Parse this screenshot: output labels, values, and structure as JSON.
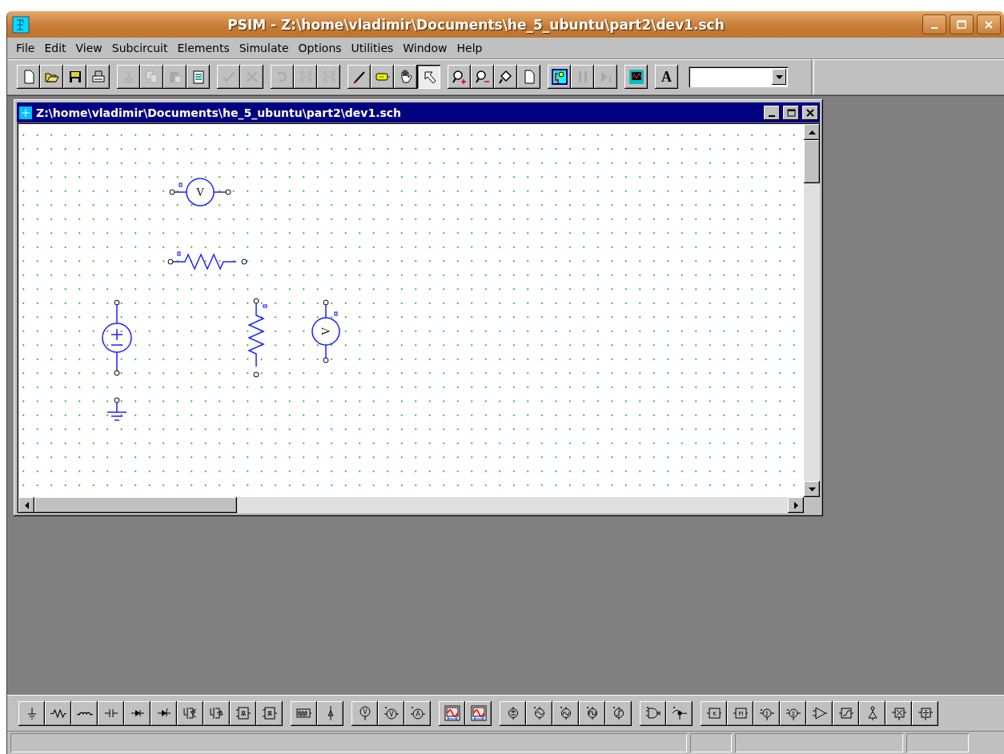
{
  "window": {
    "title": "PSIM - Z:\\home\\vladimir\\Documents\\he_5_ubuntu\\part2\\dev1.sch"
  },
  "menu": [
    {
      "label": "File"
    },
    {
      "label": "Edit"
    },
    {
      "label": "View"
    },
    {
      "label": "Subcircuit"
    },
    {
      "label": "Elements"
    },
    {
      "label": "Simulate"
    },
    {
      "label": "Options"
    },
    {
      "label": "Utilities"
    },
    {
      "label": "Window"
    },
    {
      "label": "Help"
    }
  ],
  "toolbar": [
    [
      {
        "kind": "new",
        "disabled": false,
        "pressed": false
      },
      {
        "kind": "open",
        "disabled": false,
        "pressed": false
      },
      {
        "kind": "save",
        "disabled": false,
        "pressed": false
      },
      {
        "kind": "print",
        "disabled": false,
        "pressed": false
      }
    ],
    [
      {
        "kind": "cut",
        "disabled": true,
        "pressed": false
      },
      {
        "kind": "copy",
        "disabled": true,
        "pressed": false
      },
      {
        "kind": "paste",
        "disabled": true,
        "pressed": false
      },
      {
        "kind": "clipboard",
        "disabled": false,
        "pressed": false
      }
    ],
    [
      {
        "kind": "check",
        "disabled": true,
        "pressed": false
      },
      {
        "kind": "cross",
        "disabled": true,
        "pressed": false
      }
    ],
    [
      {
        "kind": "rotate",
        "disabled": true,
        "pressed": false
      },
      {
        "kind": "flip",
        "disabled": true,
        "pressed": false
      },
      {
        "kind": "flip",
        "disabled": true,
        "pressed": false
      }
    ],
    [
      {
        "kind": "pencil",
        "disabled": false,
        "pressed": false
      },
      {
        "kind": "tag",
        "disabled": false,
        "pressed": false
      },
      {
        "kind": "hand",
        "disabled": false,
        "pressed": false
      },
      {
        "kind": "pointer",
        "disabled": false,
        "pressed": true
      }
    ],
    [
      {
        "kind": "zoom-in",
        "disabled": false,
        "pressed": false
      },
      {
        "kind": "zoom-out",
        "disabled": false,
        "pressed": false
      },
      {
        "kind": "fit",
        "disabled": false,
        "pressed": false
      },
      {
        "kind": "page",
        "disabled": false,
        "pressed": false
      }
    ],
    [
      {
        "kind": "run",
        "disabled": false,
        "pressed": false
      },
      {
        "kind": "pause",
        "disabled": true,
        "pressed": false
      },
      {
        "kind": "step",
        "disabled": true,
        "pressed": false
      }
    ],
    [
      {
        "kind": "scope",
        "disabled": false,
        "pressed": false
      }
    ],
    [
      {
        "kind": "text",
        "label": "A",
        "disabled": false,
        "pressed": false
      }
    ]
  ],
  "document": {
    "title": "Z:\\home\\vladimir\\Documents\\he_5_ubuntu\\part2\\dev1.sch",
    "components": [
      {
        "kind": "voltmeter",
        "label": "V",
        "vertical": false
      },
      {
        "kind": "resistor",
        "vertical": false
      },
      {
        "kind": "dc-source"
      },
      {
        "kind": "resistor",
        "vertical": true
      },
      {
        "kind": "voltmeter",
        "label": "V",
        "vertical": true
      },
      {
        "kind": "ground"
      }
    ]
  },
  "elements_toolbar": [
    [
      {
        "kind": "ground"
      },
      {
        "kind": "resistor"
      },
      {
        "kind": "inductor"
      },
      {
        "kind": "capacitor"
      },
      {
        "kind": "diode"
      },
      {
        "kind": "diode-rev"
      },
      {
        "kind": "igbt"
      },
      {
        "kind": "mosfet"
      },
      {
        "kind": "switch-block"
      },
      {
        "kind": "switch-block"
      }
    ],
    [
      {
        "kind": "pulse"
      },
      {
        "kind": "sensor"
      }
    ],
    [
      {
        "kind": "probe",
        "label": "V"
      },
      {
        "kind": "meter",
        "label": "V"
      },
      {
        "kind": "meter",
        "label": "A"
      }
    ],
    [
      {
        "kind": "scope-red"
      },
      {
        "kind": "scope-red"
      }
    ],
    [
      {
        "kind": "dc-source"
      },
      {
        "kind": "sine-source"
      },
      {
        "kind": "triangle-source"
      },
      {
        "kind": "square-source"
      },
      {
        "kind": "step-source"
      }
    ],
    [
      {
        "kind": "gate"
      },
      {
        "kind": "node-probe"
      }
    ],
    [
      {
        "kind": "block",
        "label": "K"
      },
      {
        "kind": "block",
        "label": "PI"
      },
      {
        "kind": "sum",
        "label": "Σ"
      },
      {
        "kind": "sum",
        "label": "Σ"
      },
      {
        "kind": "opamp"
      },
      {
        "kind": "limiter"
      },
      {
        "kind": "triangle-node"
      },
      {
        "kind": "multiplier"
      },
      {
        "kind": "divider"
      }
    ]
  ]
}
